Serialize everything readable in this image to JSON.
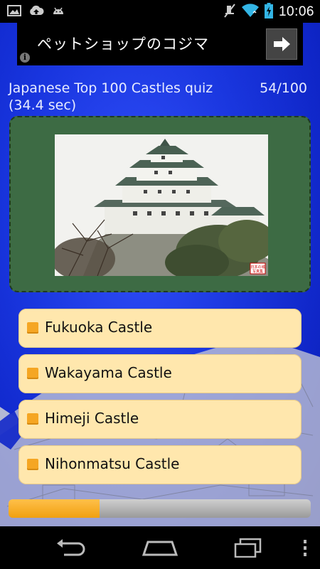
{
  "status_bar": {
    "time": "10:06",
    "left_icons": [
      "image-icon",
      "cloud-upload-icon",
      "android-icon"
    ],
    "right_icons": [
      "mute-icon",
      "wifi-icon",
      "battery-charging-icon"
    ]
  },
  "ad": {
    "text": "ペットショップのコジマ",
    "info_glyph": "i",
    "arrow_icon": "arrow-right-icon"
  },
  "quiz": {
    "title": "Japanese Top 100 Castles quiz",
    "progress_text": "54/100",
    "time_text": "(34.4 sec)",
    "photo_stamp": [
      "日本の城",
      "写真集"
    ]
  },
  "options": [
    {
      "label": "Fukuoka Castle"
    },
    {
      "label": "Wakayama Castle"
    },
    {
      "label": "Himeji Castle"
    },
    {
      "label": "Nihonmatsu Castle"
    }
  ],
  "timer_bar": {
    "fraction": 0.3
  },
  "colors": {
    "background": "#1837e6",
    "photo_frame": "#3d6b44",
    "option_bg": "#ffe7ad",
    "option_marker": "#f5a623",
    "progress_fill": "#f0a010",
    "progress_track": "#b0b0b0"
  },
  "nav_bar": {
    "icons": [
      "back-icon",
      "home-icon",
      "recent-apps-icon",
      "menu-icon"
    ]
  }
}
